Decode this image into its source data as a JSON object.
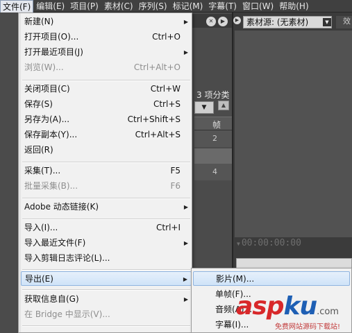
{
  "menubar": {
    "items": [
      {
        "label": "文件(F)",
        "active": true
      },
      {
        "label": "编辑(E)"
      },
      {
        "label": "项目(P)"
      },
      {
        "label": "素材(C)"
      },
      {
        "label": "序列(S)"
      },
      {
        "label": "标记(M)"
      },
      {
        "label": "字幕(T)"
      },
      {
        "label": "窗口(W)"
      },
      {
        "label": "帮助(H)"
      }
    ]
  },
  "file_menu": {
    "items": [
      {
        "label": "新建(N)",
        "shortcut": "",
        "submenu": true
      },
      {
        "label": "打开项目(O)...",
        "shortcut": "Ctrl+O"
      },
      {
        "label": "打开最近项目(J)",
        "shortcut": "",
        "submenu": true
      },
      {
        "label": "浏览(W)...",
        "shortcut": "Ctrl+Alt+O",
        "disabled": true
      },
      {
        "label": "关闭项目(C)",
        "shortcut": "Ctrl+W"
      },
      {
        "label": "保存(S)",
        "shortcut": "Ctrl+S"
      },
      {
        "label": "另存为(A)...",
        "shortcut": "Ctrl+Shift+S"
      },
      {
        "label": "保存副本(Y)...",
        "shortcut": "Ctrl+Alt+S"
      },
      {
        "label": "返回(R)",
        "shortcut": ""
      },
      {
        "label": "采集(T)...",
        "shortcut": "F5"
      },
      {
        "label": "批量采集(B)...",
        "shortcut": "F6",
        "disabled": true
      },
      {
        "label": "Adobe 动态链接(K)",
        "shortcut": "",
        "submenu": true
      },
      {
        "label": "导入(I)...",
        "shortcut": "Ctrl+I"
      },
      {
        "label": "导入最近文件(F)",
        "shortcut": "",
        "submenu": true
      },
      {
        "label": "导入剪辑日志评论(L)...",
        "shortcut": ""
      },
      {
        "label": "导出(E)",
        "shortcut": "",
        "submenu": true,
        "highlighted": true
      },
      {
        "label": "获取信息自(G)",
        "shortcut": "",
        "submenu": true
      },
      {
        "label": "在 Bridge 中显示(V)...",
        "shortcut": "",
        "disabled": true
      }
    ]
  },
  "export_submenu": {
    "items": [
      {
        "label": "影片(M)...",
        "highlighted": true
      },
      {
        "label": "单帧(F)..."
      },
      {
        "label": "音频(A)..."
      },
      {
        "label": "字幕(I)..."
      }
    ]
  },
  "background": {
    "project_category_label": "3 项分类",
    "column_header": "帧",
    "row_values": [
      "2",
      "4"
    ]
  },
  "source_monitor": {
    "tab_label": "素材源: (无素材)",
    "tab2_label": "效",
    "timecode": "00:00:00:00"
  },
  "watermark": {
    "logo_asp": "asp",
    "logo_ku": "ku",
    "logo_domain": ".com",
    "slogan": "免费网站源码下载站!"
  },
  "colors": {
    "menubar_bg": "#404040",
    "menu_bg": "#f1f1f1",
    "highlight_border": "#8fb4e0",
    "disabled_text": "#8e8e8e",
    "watermark_red": "#d8282a",
    "watermark_blue": "#1e5fb4"
  }
}
